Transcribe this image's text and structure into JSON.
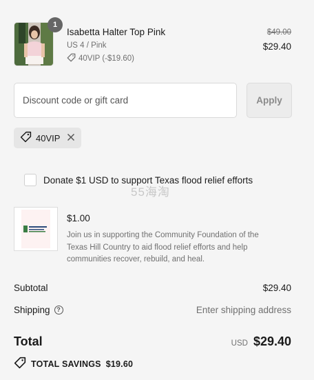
{
  "line_item": {
    "quantity": "1",
    "name": "Isabetta Halter Top Pink",
    "variant": "US 4 / Pink",
    "discount": "40VIP (-$19.60)",
    "price_original": "$49.00",
    "price_final": "$29.40"
  },
  "discount_form": {
    "placeholder": "Discount code or gift card",
    "value": "",
    "apply_label": "Apply"
  },
  "applied_code": {
    "code": "40VIP"
  },
  "donation": {
    "checkbox_label": "Donate $1 USD to support Texas flood relief efforts",
    "checked": false,
    "price": "$1.00",
    "description": "Join us in supporting the Community Foundation of the Texas Hill Country to aid flood relief efforts and help communities recover, rebuild, and heal."
  },
  "watermark": "55海淘",
  "summary": {
    "subtotal_label": "Subtotal",
    "subtotal_value": "$29.40",
    "shipping_label": "Shipping",
    "shipping_value": "Enter shipping address",
    "total_label": "Total",
    "currency": "USD",
    "total_value": "$29.40",
    "savings_label": "TOTAL SAVINGS",
    "savings_value": "$19.60"
  },
  "colors": {
    "background": "#f5f5f5",
    "text_primary": "#1a1a1a",
    "text_secondary": "#707070",
    "badge": "#666666"
  }
}
